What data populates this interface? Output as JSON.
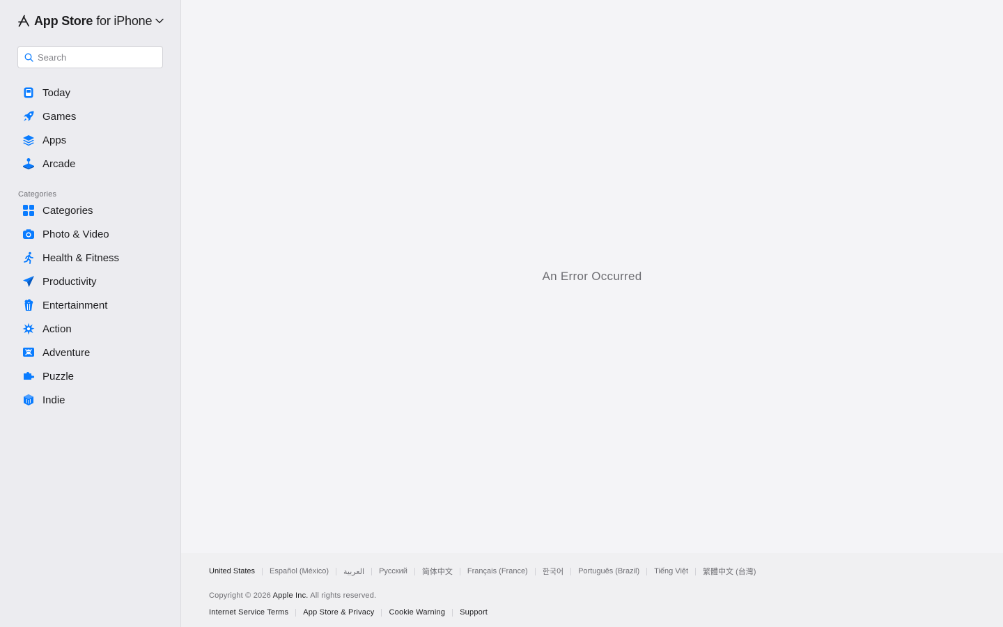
{
  "brand": {
    "title_strong": "App Store",
    "title_light": "for iPhone",
    "logo_icon": "app-store-logo-icon",
    "chevron_icon": "chevron-down-icon"
  },
  "search": {
    "placeholder": "Search",
    "value": ""
  },
  "nav": {
    "items": [
      {
        "label": "Today",
        "icon": "today-icon"
      },
      {
        "label": "Games",
        "icon": "rocket-icon"
      },
      {
        "label": "Apps",
        "icon": "layers-icon"
      },
      {
        "label": "Arcade",
        "icon": "joystick-icon"
      }
    ]
  },
  "categories": {
    "heading": "Categories",
    "items": [
      {
        "label": "Categories",
        "icon": "grid-icon"
      },
      {
        "label": "Photo & Video",
        "icon": "camera-icon"
      },
      {
        "label": "Health & Fitness",
        "icon": "running-figure-icon"
      },
      {
        "label": "Productivity",
        "icon": "paper-plane-icon"
      },
      {
        "label": "Entertainment",
        "icon": "popcorn-icon"
      },
      {
        "label": "Action",
        "icon": "burst-icon"
      },
      {
        "label": "Adventure",
        "icon": "skull-crossbones-icon"
      },
      {
        "label": "Puzzle",
        "icon": "puzzle-piece-icon"
      },
      {
        "label": "Indie",
        "icon": "indie-cube-icon"
      }
    ]
  },
  "main": {
    "error_message": "An Error Occurred"
  },
  "footer": {
    "languages": [
      "United States",
      "Español (México)",
      "العربية",
      "Русский",
      "简体中文",
      "Français (France)",
      "한국어",
      "Português (Brazil)",
      "Tiếng Việt",
      "繁體中文 (台灣)"
    ],
    "copyright_prefix": "Copyright © 2026",
    "copyright_company": "Apple Inc.",
    "copyright_suffix": "All rights reserved.",
    "links": [
      "Internet Service Terms",
      "App Store & Privacy",
      "Cookie Warning",
      "Support"
    ]
  },
  "colors": {
    "accent": "#0a7cff",
    "sidebar_bg": "#ececf0",
    "main_bg": "#f4f4f7",
    "footer_bg": "#f0f0f2",
    "muted_text": "#6e6e73"
  }
}
